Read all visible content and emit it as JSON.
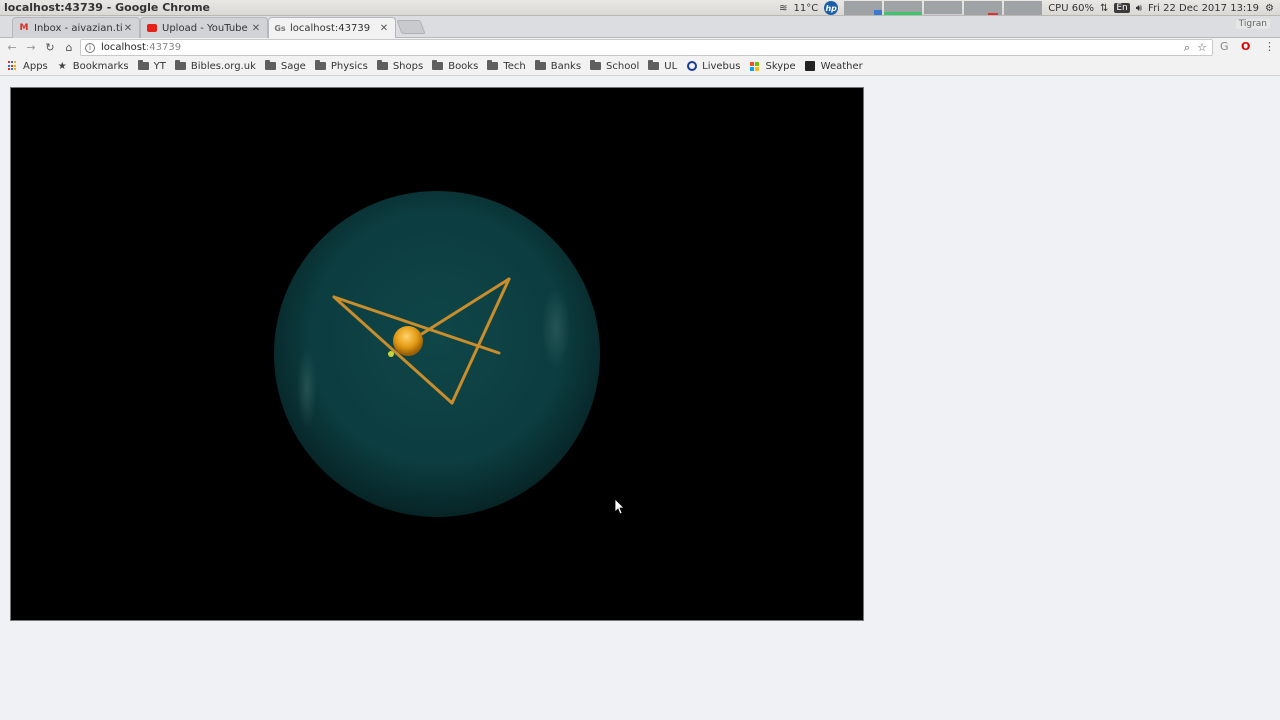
{
  "os": {
    "window_title": "localhost:43739 - Google Chrome",
    "weather": "11°C",
    "hp_label": "hp",
    "cpu": "CPU 60%",
    "lang": "En",
    "datetime": "Fri 22 Dec 2017 13:19"
  },
  "tabs": [
    {
      "title": "Inbox - aivazian.tig",
      "icon": "gmail-icon"
    },
    {
      "title": "Upload - YouTube",
      "icon": "youtube-icon"
    },
    {
      "title": "localhost:43739",
      "icon": "page-icon",
      "active": true
    }
  ],
  "profile": "Tigran",
  "address": {
    "host": "localhost",
    "port": ":43739"
  },
  "bookmarks": [
    {
      "label": "Apps",
      "icon": "apps-icon"
    },
    {
      "label": "Bookmarks",
      "icon": "star-icon"
    },
    {
      "label": "YT",
      "icon": "folder-icon"
    },
    {
      "label": "Bibles.org.uk",
      "icon": "folder-icon"
    },
    {
      "label": "Sage",
      "icon": "folder-icon"
    },
    {
      "label": "Physics",
      "icon": "folder-icon"
    },
    {
      "label": "Shops",
      "icon": "folder-icon"
    },
    {
      "label": "Books",
      "icon": "folder-icon"
    },
    {
      "label": "Tech",
      "icon": "folder-icon"
    },
    {
      "label": "Banks",
      "icon": "folder-icon"
    },
    {
      "label": "School",
      "icon": "folder-icon"
    },
    {
      "label": "UL",
      "icon": "folder-icon"
    },
    {
      "label": "Livebus",
      "icon": "livebus-icon"
    },
    {
      "label": "Skype",
      "icon": "skype-icon"
    },
    {
      "label": "Weather",
      "icon": "weather-icon"
    }
  ],
  "colors": {
    "sphere": "#0e4a4c",
    "rod": "#c98d2c",
    "ball": "#e8a21a",
    "canvas_bg": "#000000"
  }
}
